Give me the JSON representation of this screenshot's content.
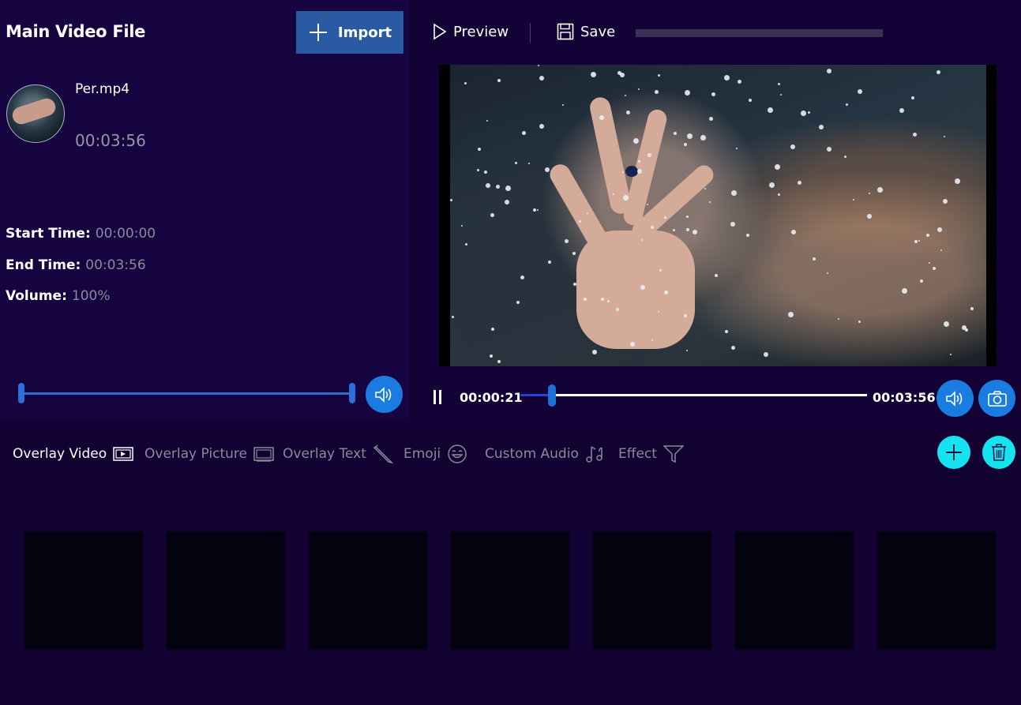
{
  "left_panel": {
    "title": "Main Video File",
    "import_label": "Import",
    "file": {
      "name": "Per.mp4",
      "duration": "00:03:56"
    },
    "meta": [
      {
        "key": "Start Time:",
        "value": "00:00:00"
      },
      {
        "key": "End Time:",
        "value": "00:03:56"
      },
      {
        "key": "Volume:",
        "value": "100%"
      }
    ]
  },
  "toolbar": {
    "preview_label": "Preview",
    "save_label": "Save"
  },
  "player": {
    "current_time": "00:00:21",
    "end_time": "00:03:56",
    "progress_fraction": 0.09
  },
  "overlay_tabs": [
    {
      "label": "Overlay Video",
      "icon": "overlay-video-icon",
      "active": true
    },
    {
      "label": "Overlay Picture",
      "icon": "overlay-picture-icon",
      "active": false
    },
    {
      "label": "Overlay Text",
      "icon": "pencil-icon",
      "active": false
    },
    {
      "label": "Emoji",
      "icon": "emoji-icon",
      "active": false
    },
    {
      "label": "Custom Audio",
      "icon": "music-note-icon",
      "active": false
    },
    {
      "label": "Effect",
      "icon": "filter-icon",
      "active": false
    }
  ],
  "colors": {
    "background": "#130236",
    "accent_blue": "#1a7ce0",
    "import_button": "#2a5aa2",
    "cyan_action": "#16e3f2",
    "muted_text": "#8e889c"
  },
  "overlay_slots_count": 7
}
